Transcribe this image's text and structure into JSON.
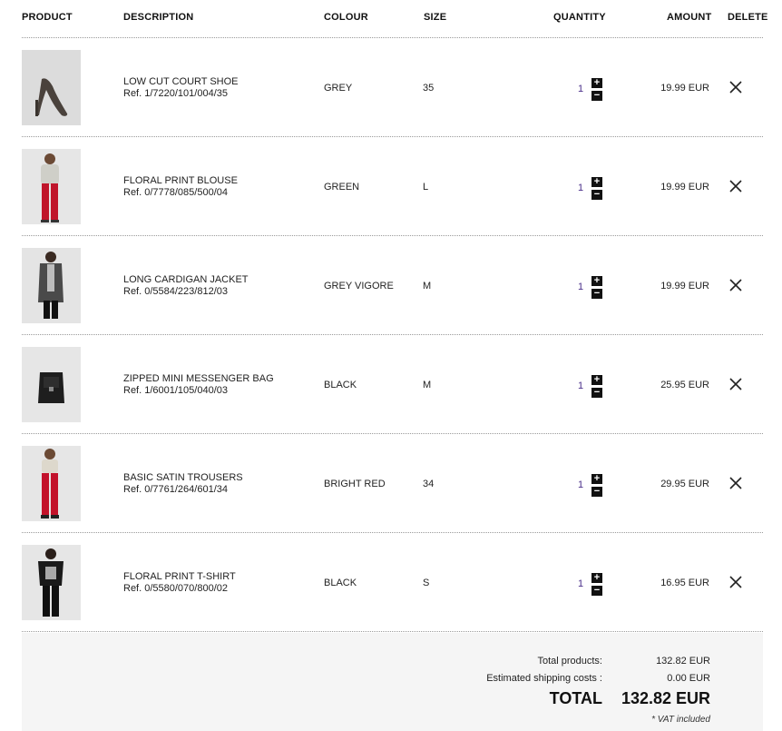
{
  "header": {
    "product": "PRODUCT",
    "description": "DESCRIPTION",
    "colour": "COLOUR",
    "size": "SIZE",
    "quantity": "QUANTITY",
    "amount": "AMOUNT",
    "delete": "DELETE"
  },
  "items": [
    {
      "name": "LOW CUT COURT SHOE",
      "ref": "Ref. 1/7220/101/004/35",
      "colour": "GREY",
      "size": "35",
      "qty": "1",
      "amount": "19.99 EUR",
      "image": "grey-court-shoe"
    },
    {
      "name": "FLORAL PRINT BLOUSE",
      "ref": "Ref. 0/7778/085/500/04",
      "colour": "GREEN",
      "size": "L",
      "qty": "1",
      "amount": "19.99 EUR",
      "image": "model-floral-blouse-red-trousers"
    },
    {
      "name": "LONG CARDIGAN JACKET",
      "ref": "Ref. 0/5584/223/812/03",
      "colour": "GREY VIGORE",
      "size": "M",
      "qty": "1",
      "amount": "19.99 EUR",
      "image": "model-long-cardigan"
    },
    {
      "name": "ZIPPED MINI MESSENGER BAG",
      "ref": "Ref. 1/6001/105/040/03",
      "colour": "BLACK",
      "size": "M",
      "qty": "1",
      "amount": "25.95 EUR",
      "image": "black-messenger-bag"
    },
    {
      "name": "BASIC SATIN TROUSERS",
      "ref": "Ref. 0/7761/264/601/34",
      "colour": "BRIGHT RED",
      "size": "34",
      "qty": "1",
      "amount": "29.95 EUR",
      "image": "model-red-satin-trousers"
    },
    {
      "name": "FLORAL PRINT T-SHIRT",
      "ref": "Ref. 0/5580/070/800/02",
      "colour": "BLACK",
      "size": "S",
      "qty": "1",
      "amount": "16.95 EUR",
      "image": "model-black-print-tshirt"
    }
  ],
  "icons": {
    "plus": "plus-icon",
    "minus": "minus-icon",
    "delete": "close-icon"
  },
  "summary": {
    "total_products_label": "Total products:",
    "total_products_value": "132.82 EUR",
    "shipping_label": "Estimated shipping costs :",
    "shipping_value": "0.00 EUR",
    "total_label": "TOTAL",
    "total_value": "132.82 EUR",
    "vat_note": "* VAT included"
  },
  "colors": {
    "quantity_text": "#4b2f8a",
    "summary_bg": "#f5f5f5",
    "dotted_rule": "#9a9a9a"
  }
}
